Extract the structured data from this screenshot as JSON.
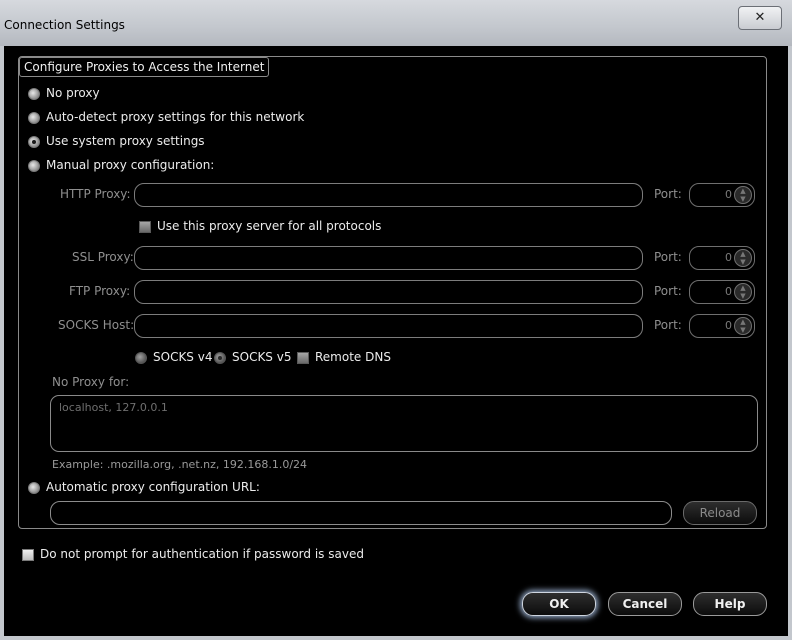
{
  "window": {
    "title": "Connection Settings",
    "close_label": "✕"
  },
  "group": {
    "title": "Configure Proxies to Access the Internet"
  },
  "proxy_options": {
    "no_proxy": "No proxy",
    "auto_detect": "Auto-detect proxy settings for this network",
    "system": "Use system proxy settings",
    "manual": "Manual proxy configuration:",
    "selected": "Use system proxy settings"
  },
  "manual": {
    "http_label": "HTTP Proxy:",
    "ssl_label": "SSL Proxy:",
    "ftp_label": "FTP Proxy:",
    "socks_label": "SOCKS Host:",
    "port_label": "Port:",
    "http_value": "",
    "ssl_value": "",
    "ftp_value": "",
    "socks_value": "",
    "http_port": "0",
    "ssl_port": "0",
    "ftp_port": "0",
    "socks_port": "0",
    "use_all_label": "Use this proxy server for all protocols",
    "socks_v4": "SOCKS v4",
    "socks_v5": "SOCKS v5",
    "socks_selected": "SOCKS v5",
    "remote_dns": "Remote DNS"
  },
  "no_proxy_for": {
    "label": "No Proxy for:",
    "value": "localhost, 127.0.0.1",
    "example": "Example: .mozilla.org, .net.nz, 192.168.1.0/24"
  },
  "auto_config": {
    "label": "Automatic proxy configuration URL:",
    "url": "",
    "reload_label": "Reload"
  },
  "auth_prompt": {
    "label": "Do not prompt for authentication if password is saved",
    "checked": false
  },
  "buttons": {
    "ok": "OK",
    "cancel": "Cancel",
    "help": "Help"
  },
  "colors": {
    "background": "#000000",
    "titlebar": "#c3c7cd",
    "text": "#e8e8e8",
    "disabled_text": "#8f8f8f",
    "default_button_glow": "#8fa3c0"
  },
  "icons": {
    "spinner": "spin-up-down-icon",
    "close": "close-icon"
  }
}
